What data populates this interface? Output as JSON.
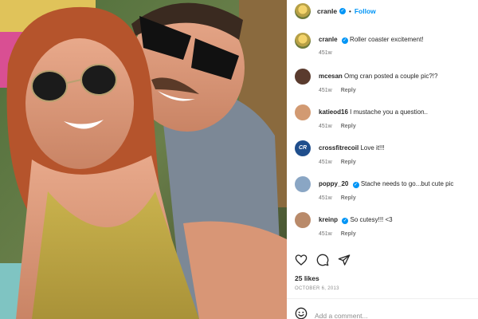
{
  "post": {
    "author": "cranle",
    "author_verified": true,
    "separator": "•",
    "follow_label": "Follow",
    "caption": "Roller coaster excitement!",
    "caption_age": "451w"
  },
  "comments": [
    {
      "user": "mcesan",
      "verified": false,
      "text": "Omg cran posted a couple pic?!?",
      "age": "451w",
      "reply_label": "Reply",
      "avatar_color": "#5a3b2e"
    },
    {
      "user": "katieod16",
      "verified": false,
      "text": "I mustache you a question..",
      "age": "451w",
      "reply_label": "Reply",
      "avatar_color": "#d29a72"
    },
    {
      "user": "crossfitrecoil",
      "verified": false,
      "text": "Love it!!!",
      "age": "451w",
      "reply_label": "Reply",
      "avatar_color": "#1f4e8c",
      "avatar_text": "CR"
    },
    {
      "user": "poppy_20",
      "verified": true,
      "text": "Stache needs to go...but cute pic",
      "age": "451w",
      "reply_label": "Reply",
      "avatar_color": "#8aa6c4"
    },
    {
      "user": "kreinp",
      "verified": true,
      "text": "So cutesy!!! <3",
      "age": "451w",
      "reply_label": "Reply",
      "avatar_color": "#b98a6a"
    }
  ],
  "actions": {
    "like_icon": "heart-icon",
    "comment_icon": "comment-icon",
    "share_icon": "share-icon"
  },
  "likes": "25 likes",
  "date": "OCTOBER 6, 2013",
  "add_comment_placeholder": "Add a comment...",
  "colors": {
    "link_blue": "#0095f6",
    "text": "#262626",
    "muted": "#737373"
  }
}
